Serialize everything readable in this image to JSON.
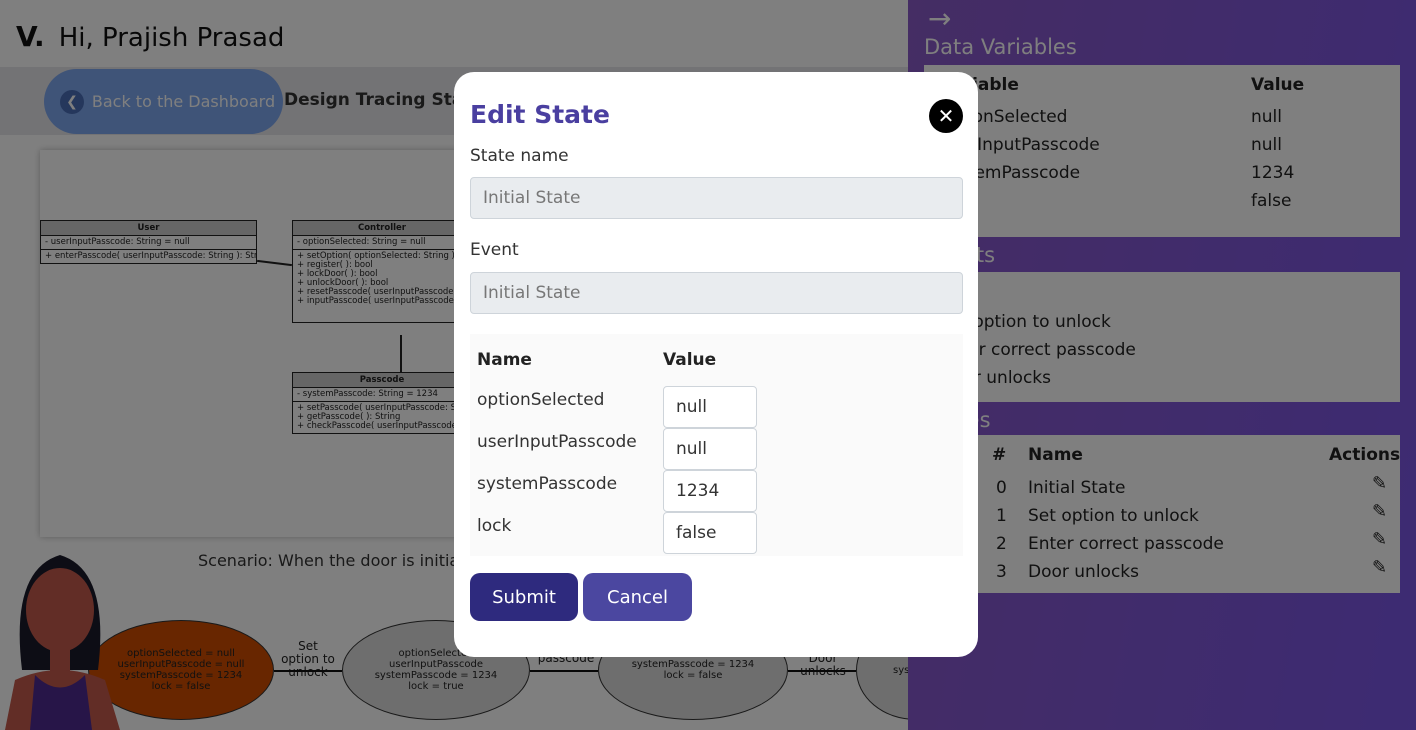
{
  "header": {
    "logo": "V.",
    "greeting": "Hi, Prajish Prasad"
  },
  "nav": {
    "back_label": "Back to the Dashboard",
    "stage": "Design Tracing Stage"
  },
  "uml": {
    "user": {
      "title": "User",
      "attr": "- userInputPasscode: String = null",
      "methods": [
        "+ enterPasscode( userInputPasscode: String ): String"
      ]
    },
    "controller": {
      "title": "Controller",
      "attr": "- optionSelected: String = null",
      "methods": [
        "+ setOption( optionSelected: String ): String",
        "+ register( ): bool",
        "+ lockDoor( ): bool",
        "+ unlockDoor( ): bool",
        "+ resetPasscode( userInputPasscode: String",
        "+ inputPasscode( userInputPasscode: String"
      ]
    },
    "passcode": {
      "title": "Passcode",
      "attr": "- systemPasscode: String = 1234",
      "methods": [
        "+ setPasscode( userInputPasscode: String",
        "+ getPasscode( ): String",
        "+ checkPasscode( userInputPasscode: String"
      ]
    }
  },
  "scenario": "Scenario: When the door is initially",
  "states_diagram": {
    "s0": [
      "optionSelected = null",
      "userInputPasscode = null",
      "systemPasscode = 1234",
      "lock = false"
    ],
    "s1": [
      "optionSelected",
      "userInputPasscode",
      "systemPasscode = 1234",
      "lock = true"
    ],
    "s2": [
      "systemPasscode = 1234",
      "lock = false"
    ],
    "s3": [
      "sys"
    ],
    "t1": "Set option to unlock",
    "t2": "passcode",
    "t3": "Door unlocks"
  },
  "right": {
    "data_title": "Data Variables",
    "var_header": "Variable",
    "val_header": "Value",
    "vars": [
      {
        "n": "optionSelected",
        "v": "null"
      },
      {
        "n": "userInputPasscode",
        "v": "null"
      },
      {
        "n": "systemPasscode",
        "v": "1234"
      },
      {
        "n": "lock",
        "v": "false"
      }
    ],
    "events_title": "Events",
    "events": [
      "Set option to unlock",
      "Enter correct passcode",
      "Door unlocks"
    ],
    "states_title": "States",
    "states_headers": {
      "num": "#",
      "name": "Name",
      "actions": "Actions"
    },
    "states": [
      {
        "i": "0",
        "n": "Initial State"
      },
      {
        "i": "1",
        "n": "Set option to unlock"
      },
      {
        "i": "2",
        "n": "Enter correct passcode"
      },
      {
        "i": "3",
        "n": "Door unlocks"
      }
    ]
  },
  "modal": {
    "title": "Edit State",
    "state_name_label": "State name",
    "state_name_value": "Initial State",
    "event_label": "Event",
    "event_value": "Initial State",
    "name_header": "Name",
    "value_header": "Value",
    "vars": [
      {
        "n": "optionSelected",
        "v": "null"
      },
      {
        "n": "userInputPasscode",
        "v": "null"
      },
      {
        "n": "systemPasscode",
        "v": "1234"
      },
      {
        "n": "lock",
        "v": "false"
      }
    ],
    "submit": "Submit",
    "cancel": "Cancel"
  },
  "colors": {
    "accent": "#4a3fa0",
    "submit": "#2e2a7e",
    "cancel": "#4b47a0"
  }
}
